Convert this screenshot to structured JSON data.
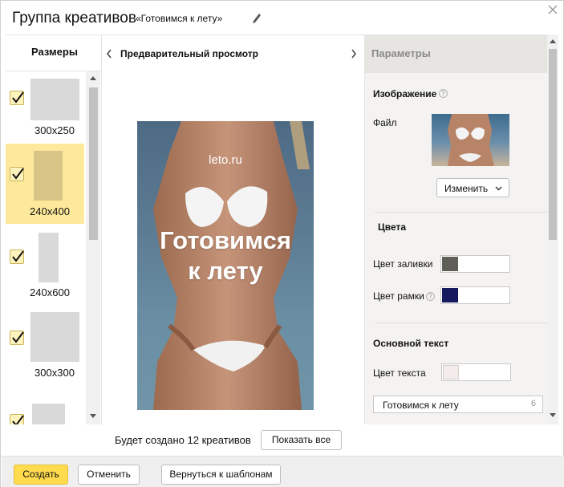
{
  "header": {
    "title": "Группа креативов",
    "subtitle": "«Готовимся к лету»"
  },
  "sizes": {
    "title": "Размеры",
    "items": [
      {
        "label": "300x250",
        "checked": true,
        "selected": false
      },
      {
        "label": "240x400",
        "checked": true,
        "selected": true
      },
      {
        "label": "240x600",
        "checked": true,
        "selected": false
      },
      {
        "label": "300x300",
        "checked": true,
        "selected": false
      },
      {
        "label": "",
        "checked": true,
        "selected": false
      }
    ]
  },
  "preview": {
    "title": "Предварительный просмотр",
    "creative": {
      "domain": "leto.ru",
      "headline_line1": "Готовимся",
      "headline_line2": "к лету"
    }
  },
  "params": {
    "title": "Параметры",
    "image": {
      "title": "Изображение",
      "file_label": "Файл",
      "change_button": "Изменить"
    },
    "colors": {
      "title": "Цвета",
      "fill_label": "Цвет заливки",
      "fill_color": "#5f5f57",
      "border_label": "Цвет рамки",
      "border_color": "#151a5e"
    },
    "main_text": {
      "title": "Основной текст",
      "text_color_label": "Цвет текста",
      "text_color": "#f3ecea",
      "value": "Готовимся к лету",
      "counter": "6"
    }
  },
  "bottom": {
    "info": "Будет создано 12 креативов",
    "show_all": "Показать все"
  },
  "footer": {
    "create": "Создать",
    "cancel": "Отменить",
    "back": "Вернуться к шаблонам"
  }
}
